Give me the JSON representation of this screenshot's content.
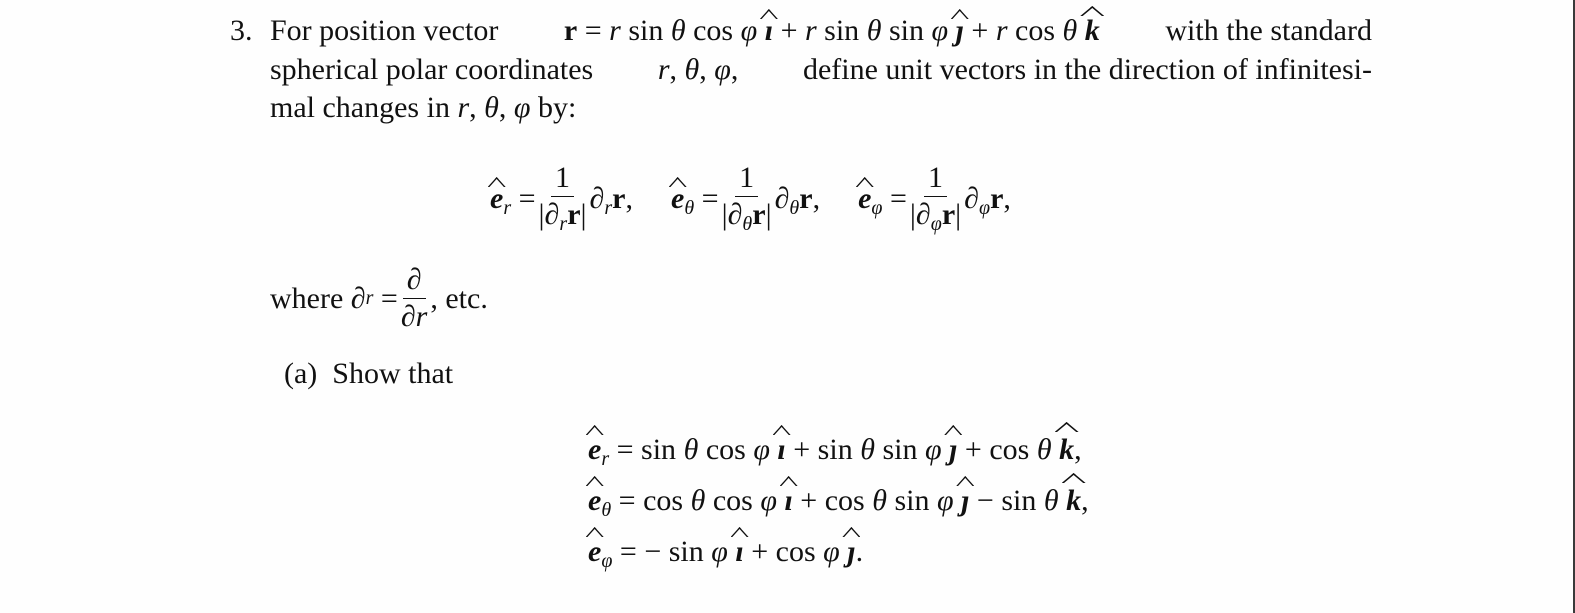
{
  "problem": {
    "number": "3.",
    "intro_lines": [
      "For position vector r = r sin θ cos φ î + r sin θ sin φ ĵ + r cos θ k̂ with the standard",
      "spherical polar coordinates r, θ, φ, define unit vectors in the direction of infinitesi-",
      "mal changes in r, θ, φ by:"
    ],
    "text": {
      "for_position_vector": "For position vector",
      "with_the_standard": "with the standard",
      "spherical_polar": "spherical polar coordinates",
      "define_unit": "define unit vectors in the direction of infinitesi-",
      "mal_changes": "mal changes in",
      "by": "by:",
      "where": "where",
      "etc": "etc."
    },
    "definitions": [
      {
        "lhs": "ê_r",
        "numerator": "1",
        "denominator": "|∂_r r|",
        "rhs": "∂_r r,"
      },
      {
        "lhs": "ê_θ",
        "numerator": "1",
        "denominator": "|∂_θ r|",
        "rhs": "∂_θ r,"
      },
      {
        "lhs": "ê_φ",
        "numerator": "1",
        "denominator": "|∂_φ r|",
        "rhs": "∂_φ r,"
      }
    ],
    "where_clause": {
      "lhs": "∂_r",
      "numerator": "∂",
      "denominator": "∂r"
    },
    "part_a": {
      "label": "(a)",
      "text": "Show that",
      "results": [
        "ê_r = sin θ cos φ î + sin θ sin φ ĵ + cos θ k̂,",
        "ê_θ = cos θ cos φ î + cos θ sin φ ĵ − sin θ k̂,",
        "ê_φ = − sin φ î + cos φ ĵ."
      ]
    }
  }
}
